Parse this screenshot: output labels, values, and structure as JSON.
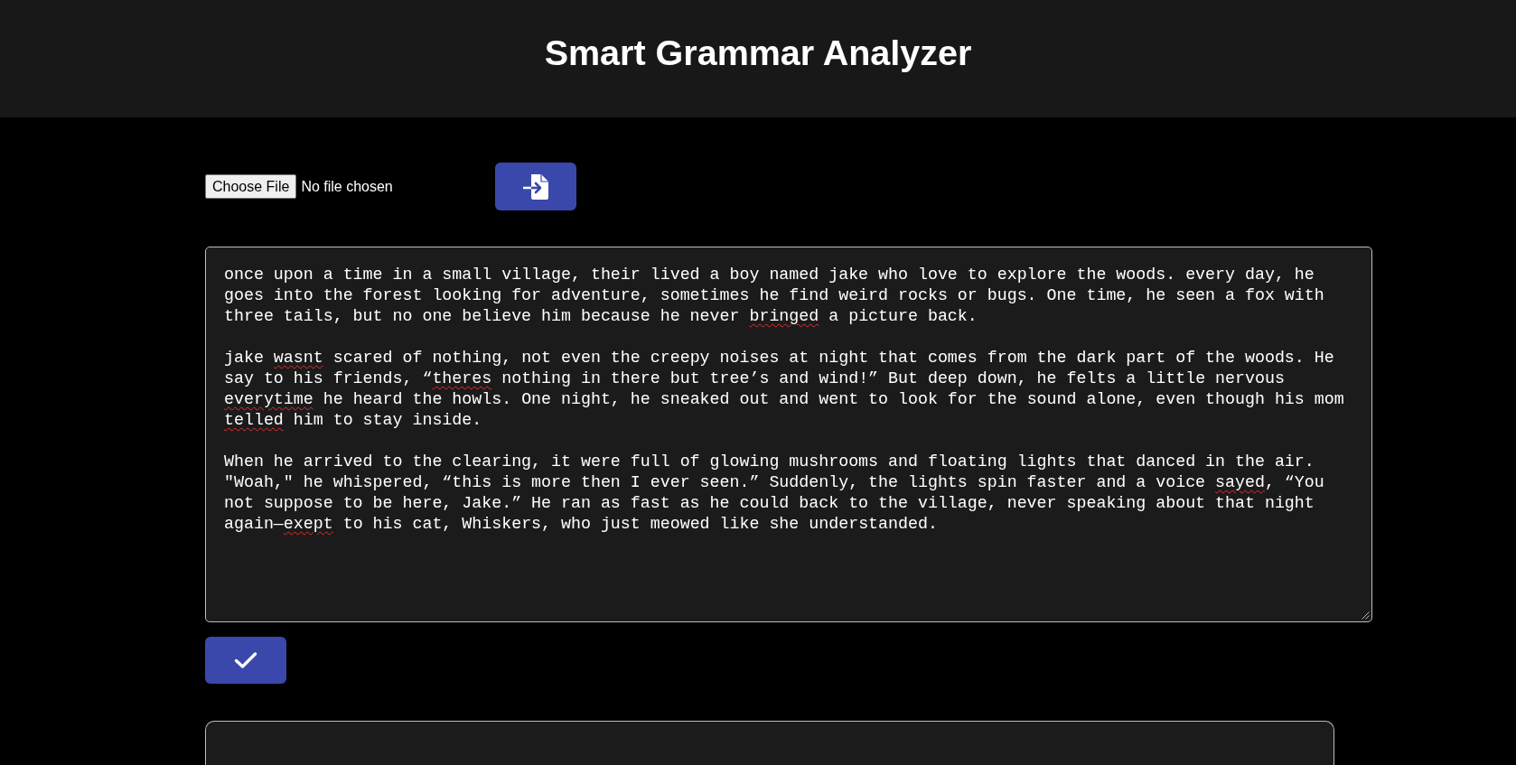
{
  "header": {
    "title": "Smart Grammar Analyzer"
  },
  "file_picker": {
    "button_label": "Choose File",
    "status": "No file chosen"
  },
  "text_area": {
    "paragraphs": [
      {
        "segments": [
          {
            "text": "once upon a time in a small village, their lived a boy named jake who love to explore the woods. every day, he goes into the forest looking for adventure, sometimes he find weird rocks or bugs. One time, he seen a fox with three tails, but no one believe him because he never ",
            "misspelled": false
          },
          {
            "text": "bringed",
            "misspelled": true
          },
          {
            "text": " a picture back.",
            "misspelled": false
          }
        ]
      },
      {
        "segments": [
          {
            "text": "jake ",
            "misspelled": false
          },
          {
            "text": "wasnt",
            "misspelled": true
          },
          {
            "text": " scared of nothing, not even the creepy noises at night that comes from the dark part of the woods. He say to his friends, “",
            "misspelled": false
          },
          {
            "text": "theres",
            "misspelled": true
          },
          {
            "text": " nothing in there but tree’s and wind!” But deep down, he felts a little nervous ",
            "misspelled": false
          },
          {
            "text": "everytime",
            "misspelled": true
          },
          {
            "text": " he heard the howls. One night, he sneaked out and went to look for the sound alone, even though his mom ",
            "misspelled": false
          },
          {
            "text": "telled",
            "misspelled": true
          },
          {
            "text": " him to stay inside.",
            "misspelled": false
          }
        ]
      },
      {
        "segments": [
          {
            "text": "When he arrived to the clearing, it were full of glowing mushrooms and floating lights that danced in the air. \"Woah,\" he whispered, “this is more then I ever seen.” Suddenly, the lights spin faster and a voice ",
            "misspelled": false
          },
          {
            "text": "sayed",
            "misspelled": true
          },
          {
            "text": ", “You not suppose to be here, Jake.” He ran as fast as he could back to the village, never speaking about that night again—",
            "misspelled": false
          },
          {
            "text": "exept",
            "misspelled": true
          },
          {
            "text": " to his cat, Whiskers, who just meowed like she understanded.",
            "misspelled": false
          }
        ]
      }
    ]
  }
}
